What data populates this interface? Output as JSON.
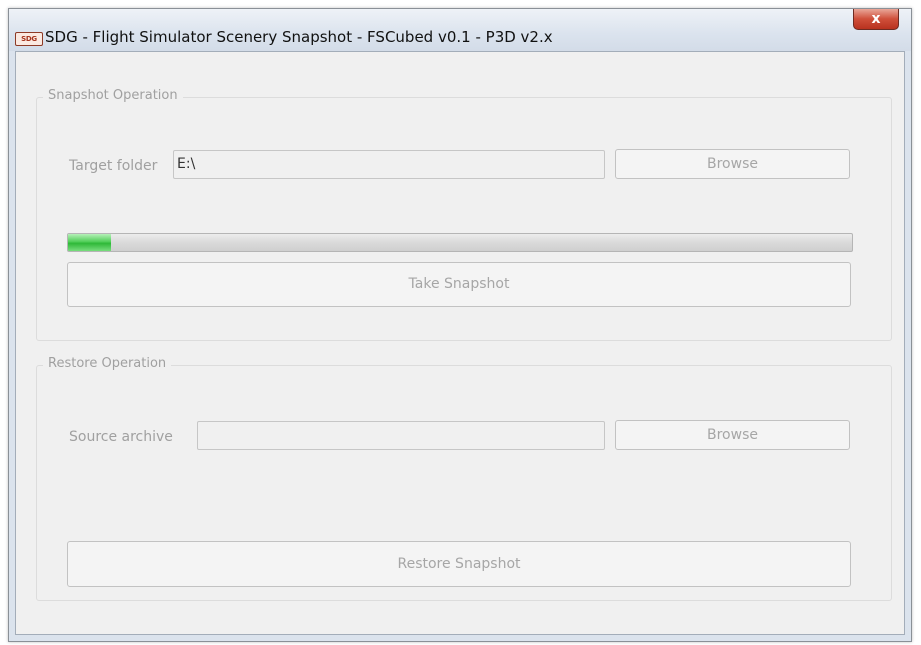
{
  "window": {
    "app_icon_text": "SDG",
    "title": "SDG - Flight Simulator Scenery Snapshot - FSCubed v0.1 - P3D v2.x",
    "close_glyph": "x"
  },
  "snapshot": {
    "legend": "Snapshot Operation",
    "target_label": "Target folder",
    "target_value": "E:\\",
    "browse_label": "Browse",
    "progress_fraction": 0.055,
    "progress_color": "#3cc444",
    "take_label": "Take Snapshot"
  },
  "restore": {
    "legend": "Restore Operation",
    "source_label": "Source archive",
    "source_value": "",
    "browse_label": "Browse",
    "restore_label": "Restore Snapshot"
  }
}
